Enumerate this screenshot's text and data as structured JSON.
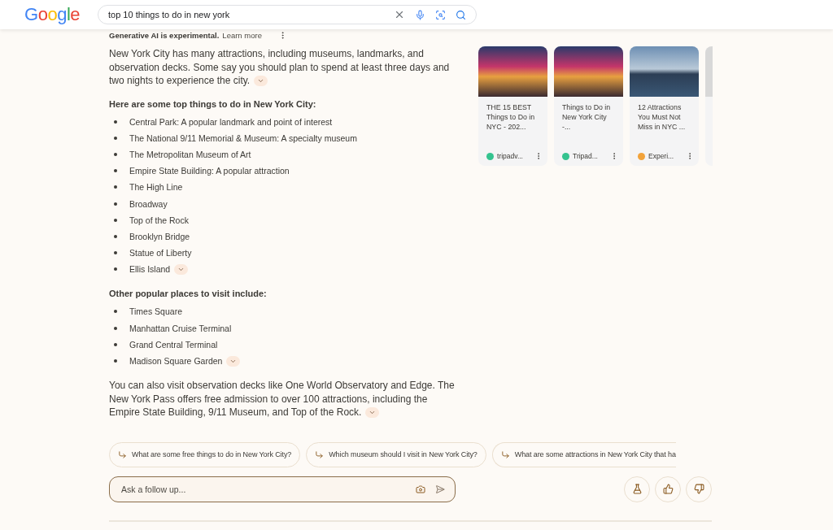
{
  "header": {
    "logo": "Google",
    "query": "top 10 things to do in new york"
  },
  "notice": {
    "text": "Generative AI is experimental.",
    "link": "Learn more"
  },
  "intro": "New York City has many attractions, including museums, landmarks, and observation decks. Some say you should plan to spend at least three days and two nights to experience the city.",
  "sections": [
    {
      "heading": "Here are some top things to do in New York City:",
      "items": [
        "Central Park: A popular landmark and point of interest",
        "The National 9/11 Memorial & Museum: A specialty museum",
        "The Metropolitan Museum of Art",
        "Empire State Building: A popular attraction",
        "The High Line",
        "Broadway",
        "Top of the Rock",
        "Brooklyn Bridge",
        "Statue of Liberty",
        "Ellis Island"
      ]
    },
    {
      "heading": "Other popular places to visit include:",
      "items": [
        "Times Square",
        "Manhattan Cruise Terminal",
        "Grand Central Terminal",
        "Madison Square Garden"
      ]
    }
  ],
  "closing": "You can also visit observation decks like One World Observatory and Edge. The New York Pass offers free admission to over 100 attractions, including the Empire State Building, 9/11 Museum, and Top of the Rock.",
  "cards": [
    {
      "title": "THE 15 BEST Things to Do in NYC - 202...",
      "source": "tripadv...",
      "kind": "street",
      "color": "#34c38f"
    },
    {
      "title": "Things to Do in New York City -...",
      "source": "Tripad...",
      "kind": "street",
      "color": "#34c38f"
    },
    {
      "title": "12 Attractions You Must Not Miss in NYC ...",
      "source": "Experi...",
      "kind": "skyline",
      "color": "#f2a33a"
    }
  ],
  "suggestions": [
    "What are some free things to do in New York City?",
    "Which museum should I visit in New York City?",
    "What are some attractions in New York City that ha"
  ],
  "followup": {
    "placeholder": "Ask a follow up..."
  }
}
